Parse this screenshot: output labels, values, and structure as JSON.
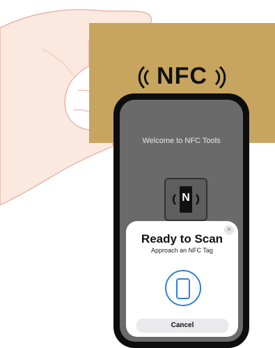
{
  "card": {
    "logo_text": "NFC"
  },
  "phone": {
    "welcome_text": "Welcome to NFC Tools",
    "tag_letter": "N"
  },
  "sheet": {
    "title": "Ready to Scan",
    "subtitle": "Approach an NFC Tag",
    "close_icon": "×",
    "cancel_label": "Cancel",
    "accent_color": "#2f7fd4"
  },
  "icons": [
    "nfc-waves-icon",
    "nfc-tag-icon",
    "close-icon",
    "phone-scan-icon"
  ]
}
